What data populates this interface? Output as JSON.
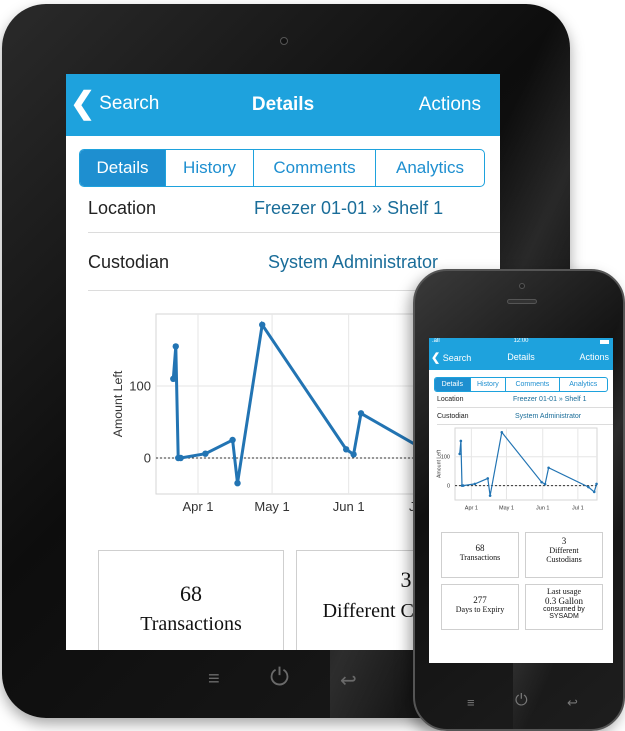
{
  "navbar": {
    "back_label": "Search",
    "title": "Details",
    "actions_label": "Actions"
  },
  "tabs": [
    {
      "label": "Details",
      "active": true
    },
    {
      "label": "History",
      "active": false
    },
    {
      "label": "Comments",
      "active": false
    },
    {
      "label": "Analytics",
      "active": false
    }
  ],
  "fields": [
    {
      "label": "Location",
      "value": "Freezer 01-01 » Shelf 1"
    },
    {
      "label": "Custodian",
      "value": "System Administrator"
    }
  ],
  "chart_data": {
    "type": "line",
    "ylabel": "Amount Left",
    "yticks": [
      0,
      100
    ],
    "xticks": [
      "Apr 1",
      "May 1",
      "Jun 1",
      "Jul 1"
    ],
    "ylim": [
      -50,
      200
    ],
    "zero_line": "dotted",
    "grid": true,
    "series": [
      {
        "values_by_day": [
          [
            3,
            110
          ],
          [
            4,
            155
          ],
          [
            5,
            0
          ],
          [
            6,
            0
          ],
          [
            16,
            6
          ],
          [
            27,
            25
          ],
          [
            29,
            -35
          ],
          [
            39,
            185
          ],
          [
            73,
            12
          ],
          [
            76,
            5
          ],
          [
            79,
            62
          ],
          [
            113,
            -5
          ]
        ]
      }
    ],
    "phone_series_extra": [
      [
        118,
        -22
      ],
      [
        120,
        6
      ]
    ]
  },
  "cards": {
    "transactions_count": "68",
    "transactions_label": "Transactions",
    "custodians_count": "3",
    "custodians_label": "Different Custodians",
    "custodians_label_line1": "Different",
    "custodians_label_line2": "Custodians",
    "expiry_count": "277",
    "expiry_label": "Days to Expiry",
    "last_usage_title": "Last usage",
    "last_usage_amount": "0.3 Gallon",
    "last_usage_by": "consumed by SYSADM",
    "last_usage_by_line1": "consumed by",
    "last_usage_by_line2": "SYSADM"
  },
  "phone_status": {
    "time": "12:00",
    "signal": ".all"
  },
  "colors": {
    "accent": "#1ea2dd",
    "line": "#2274b3",
    "link": "#1a6d99"
  },
  "icons": {
    "back": "chevron-left-icon",
    "home": "menu-icon",
    "power": "power-icon",
    "return": "return-icon"
  }
}
